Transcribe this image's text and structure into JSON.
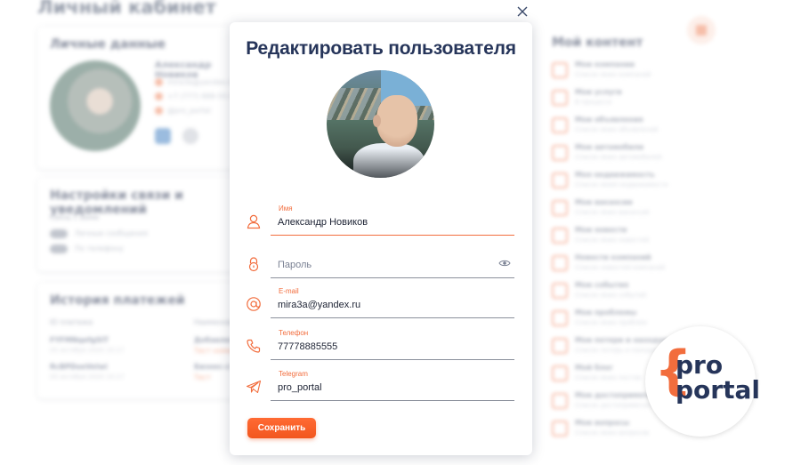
{
  "background": {
    "page_title": "Личный кабинет",
    "personal": {
      "title": "Личные данные",
      "name": "Александр Новиков",
      "contacts": [
        "mira3a@yandex.ru",
        "+7 (777) 888-55-55",
        "@pro_portal"
      ]
    },
    "notifications": {
      "title": "Настройки связи и уведомлений",
      "sublabel": "Связь с Вами",
      "toggles": [
        "Личные сообщения",
        "По телефону"
      ]
    },
    "payments": {
      "title": "История платежей",
      "column_label": "ID платежа",
      "column_label2": "Наименование",
      "rows": [
        {
          "id": "FYFMNqefgSIT",
          "date": "05 октября 2020 15:17",
          "name": "Добавление",
          "link": "Тест номер"
        },
        {
          "id": "RcBPDoeVeIwi",
          "date": "05 октября 2020 15:17",
          "name": "Бизнес-ст",
          "link": "Тест"
        }
      ]
    },
    "my_content": {
      "title": "Мой контент",
      "items": [
        {
          "title": "Мои компании",
          "sub": "Список моих компаний"
        },
        {
          "title": "Мои услуги",
          "sub": "В процессе"
        },
        {
          "title": "Мои объявления",
          "sub": "Список моих объявлений"
        },
        {
          "title": "Мои автомобили",
          "sub": "Список моих автомобилей"
        },
        {
          "title": "Моя недвижимость",
          "sub": "Список моей недвижимости"
        },
        {
          "title": "Мои вакансии",
          "sub": "Список моих вакансий"
        },
        {
          "title": "Мои новости",
          "sub": "Список моих новостей"
        },
        {
          "title": "Новости компаний",
          "sub": "Список новостей компаний"
        },
        {
          "title": "Мои события",
          "sub": "Список моих событий"
        },
        {
          "title": "Мои проблемы",
          "sub": "Список моих проблем"
        },
        {
          "title": "Мои потери и находки",
          "sub": "Список потерь и находок"
        },
        {
          "title": "Мой блог",
          "sub": "Список моих постов"
        },
        {
          "title": "Мои достопримечательности",
          "sub": "Список достопримечательностей"
        },
        {
          "title": "Мои вопросы",
          "sub": "Список моих вопросов"
        }
      ]
    }
  },
  "modal": {
    "title": "Редактировать пользователя",
    "fields": [
      {
        "key": "name",
        "label": "Имя",
        "value": "Александр Новиков",
        "placeholder": "",
        "icon": "person-icon"
      },
      {
        "key": "password",
        "label": "",
        "value": "",
        "placeholder": "Пароль",
        "icon": "lock-icon"
      },
      {
        "key": "email",
        "label": "E-mail",
        "value": "mira3a@yandex.ru",
        "placeholder": "",
        "icon": "at-icon"
      },
      {
        "key": "phone",
        "label": "Телефон",
        "value": "77778885555",
        "placeholder": "",
        "icon": "phone-icon"
      },
      {
        "key": "telegram",
        "label": "Telegram",
        "value": "pro_portal",
        "placeholder": "",
        "icon": "telegram-icon"
      }
    ],
    "save_label": "Сохранить"
  },
  "logo": {
    "line1": "pro",
    "line2": "portal"
  },
  "colors": {
    "accent": "#f26d3d",
    "title": "#26355a",
    "button": "#f2561e"
  }
}
